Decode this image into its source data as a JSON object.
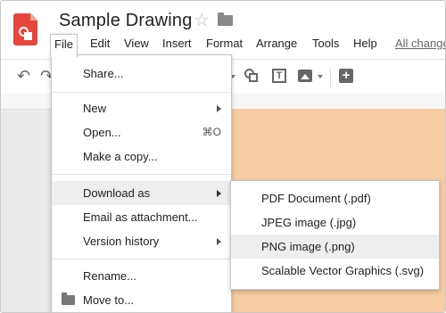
{
  "app": {
    "title": "Sample Drawing",
    "icons": {
      "logo": "google-drawings-logo-icon",
      "star": "star-icon",
      "folder": "folder-icon"
    },
    "colors": {
      "logo": "#e8453c",
      "page": "#f7cda3"
    }
  },
  "menubar": {
    "items": [
      "File",
      "Edit",
      "View",
      "Insert",
      "Format",
      "Arrange",
      "Tools",
      "Help"
    ],
    "active": "File",
    "changes_link": "All change"
  },
  "toolbar": {
    "icons": [
      "undo-icon",
      "redo-icon",
      "shape-icon",
      "text-box-icon",
      "image-icon",
      "add-comment-icon"
    ]
  },
  "file_menu": {
    "share": "Share...",
    "new": "New",
    "open": "Open...",
    "open_shortcut": "⌘O",
    "make_copy": "Make a copy...",
    "download_as": "Download as",
    "email_attachment": "Email as attachment...",
    "version_history": "Version history",
    "rename": "Rename...",
    "move_to": "Move to..."
  },
  "download_submenu": {
    "items": [
      "PDF Document (.pdf)",
      "JPEG image (.jpg)",
      "PNG image (.png)",
      "Scalable Vector Graphics (.svg)"
    ],
    "highlighted": "PNG image (.png)"
  }
}
